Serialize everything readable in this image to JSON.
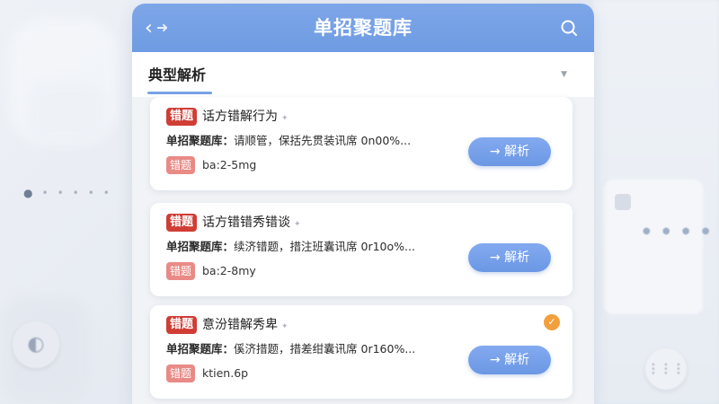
{
  "app": {
    "title": "单招聚题库",
    "back_icon": "back-arrow-icon",
    "search_icon": "search-icon"
  },
  "section": {
    "title": "典型解析"
  },
  "colors": {
    "header": "#6e9be2",
    "badge": "#cf3d35",
    "tag": "#e98a86",
    "button": "#6b97e4",
    "check": "#f2a03d"
  },
  "cards": [
    {
      "badge": "错题",
      "title": "话方错解行为",
      "meta_label": "单招聚题库：",
      "meta_text": "请顺管，保括先贯装讯席 0n00%...",
      "tag": "错题",
      "code": "ba:2-5mg",
      "button": "→ 解析",
      "checked": false
    },
    {
      "badge": "错题",
      "title": "话方错错秀错谈",
      "meta_label": "单招聚题库：",
      "meta_text": "续济错题，措注班囊讯席 0r10o%...",
      "tag": "错题",
      "code": "ba:2-8my",
      "button": "→ 解析",
      "checked": false
    },
    {
      "badge": "错题",
      "title": "意汾错解秀卑",
      "meta_label": "单招聚题库：",
      "meta_text": "傒济措题，措差绀囊讯席 0r160%...",
      "tag": "错题",
      "code": "ktien.6p",
      "button": "→ 解析",
      "checked": true
    }
  ]
}
